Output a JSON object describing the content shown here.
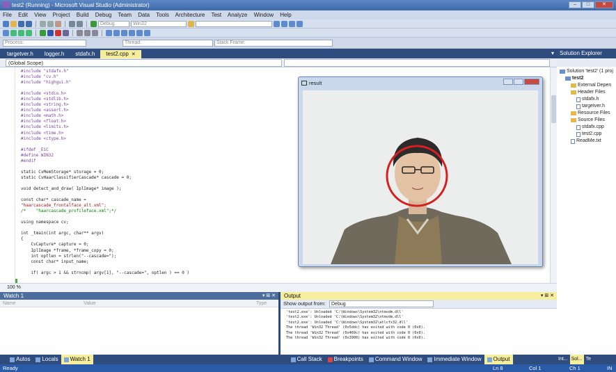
{
  "window": {
    "title": "test2 (Running) - Microsoft Visual Studio (Administrator)"
  },
  "menu": [
    "File",
    "Edit",
    "View",
    "Project",
    "Build",
    "Debug",
    "Team",
    "Data",
    "Tools",
    "Architecture",
    "Test",
    "Analyze",
    "Window",
    "Help"
  ],
  "toolbar": {
    "config": "Debug",
    "platform": "Win32",
    "process_label": "Process:",
    "thread_label": "Thread:",
    "stackframe_label": "Stack Frame:"
  },
  "doc_tabs": [
    "targetver.h",
    "logger.h",
    "stdafx.h",
    "test2.cpp"
  ],
  "editor": {
    "scope": "(Global Scope)",
    "zoom": "100 %",
    "lines": [
      "#include \"stdafx.h\"",
      "#include \"cv.h\"",
      "#include \"highgui.h\"",
      "",
      "#include <stdio.h>",
      "#include <stdlib.h>",
      "#include <string.h>",
      "#include <assert.h>",
      "#include <math.h>",
      "#include <float.h>",
      "#include <limits.h>",
      "#include <time.h>",
      "#include <ctype.h>",
      "",
      "#ifdef _EiC",
      "#define WIN32",
      "#endif",
      "",
      "static CvMemStorage* storage = 0;",
      "static CvHaarClassifierCascade* cascade = 0;",
      "",
      "void detect_and_draw( IplImage* image );",
      "",
      "const char* cascade_name =",
      "\"haarcascade_frontalface_alt.xml\";",
      "/*    \"haarcascade_profileface.xml\";*/",
      "",
      "using namespace cv;",
      "",
      "int _tmain(int argc, char** argv)",
      "{",
      "    CvCapture* capture = 0;",
      "    IplImage *frame, *frame_copy = 0;",
      "    int optlen = strlen(\"--cascade=\");",
      "    const char* input_name;",
      "",
      "    if( argc > 1 && strncmp( argv[1], \"--cascade=\", optlen ) == 0 )"
    ]
  },
  "result_window": {
    "title": "result"
  },
  "watch": {
    "title": "Watch 1",
    "columns": [
      "Name",
      "Value",
      "Type"
    ]
  },
  "output": {
    "title": "Output",
    "show_from_label": "Show output from:",
    "show_from_value": "Debug",
    "lines": [
      "'test2.exe': Unloaded 'C:\\Windows\\System32\\ntmvdm.dll'",
      "'test2.exe': Unloaded 'C:\\Windows\\System32\\ntmvdm.dll'",
      "'test2.exe': Unloaded 'C:\\Windows\\System32\\atlcfx32.dll'",
      "The thread 'Win32 Thread' (0x5ddc) has exited with code 0 (0x0).",
      "The thread 'Win32 Thread' (0x469c) has exited with code 0 (0x0).",
      "The thread 'Win32 Thread' (0x3900) has exited with code 0 (0x0)."
    ]
  },
  "bottom_tabs_left": [
    "Autos",
    "Locals",
    "Watch 1"
  ],
  "bottom_tabs_right": [
    "Call Stack",
    "Breakpoints",
    "Command Window",
    "Immediate Window",
    "Output"
  ],
  "solution": {
    "title": "Solution Explorer",
    "items": [
      {
        "label": "Solution 'test2' (1 proj",
        "kind": "solution",
        "indent": 0
      },
      {
        "label": "test2",
        "kind": "project",
        "indent": 1
      },
      {
        "label": "External Depen",
        "kind": "folder",
        "indent": 2
      },
      {
        "label": "Header Files",
        "kind": "folder",
        "indent": 2
      },
      {
        "label": "stdafx.h",
        "kind": "file",
        "indent": 3
      },
      {
        "label": "targetver.h",
        "kind": "file",
        "indent": 3
      },
      {
        "label": "Resource Files",
        "kind": "folder",
        "indent": 2
      },
      {
        "label": "Source Files",
        "kind": "folder",
        "indent": 2
      },
      {
        "label": "stdafx.cpp",
        "kind": "file",
        "indent": 3
      },
      {
        "label": "test2.cpp",
        "kind": "file",
        "indent": 3
      },
      {
        "label": "ReadMe.txt",
        "kind": "file",
        "indent": 2
      }
    ],
    "bottom_tabs": [
      "Int...",
      "Sol...",
      "Te"
    ]
  },
  "status": {
    "ready": "Ready",
    "ln": "Ln 8",
    "col": "Col 1",
    "ch": "Ch 1",
    "ins": "IN"
  }
}
